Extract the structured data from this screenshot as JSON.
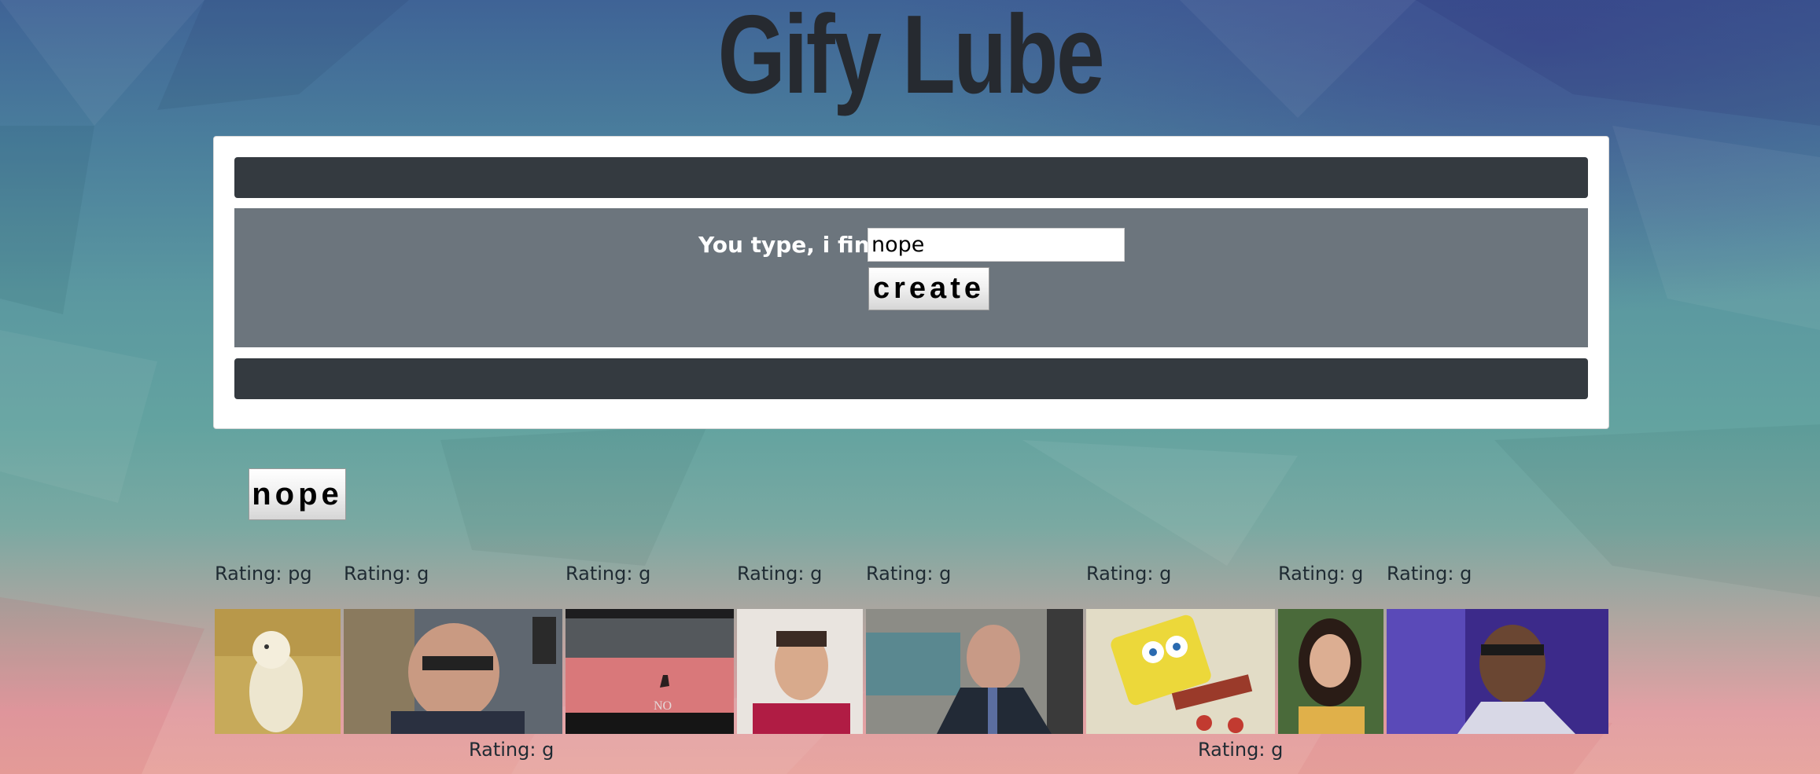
{
  "app": {
    "title": "Gify Lube"
  },
  "form": {
    "label": "You type, i find",
    "input_value": "nope",
    "create_label": "create"
  },
  "topics": [
    {
      "label": "nope"
    }
  ],
  "gifs": [
    {
      "rating": "Rating: pg",
      "subject": "white-cockatoo-gif"
    },
    {
      "rating": "Rating: g",
      "subject": "man-with-glasses-gif"
    },
    {
      "rating": "Rating: g",
      "subject": "deer-on-beach-no-gif"
    },
    {
      "rating": "Rating: g",
      "subject": "man-red-hoodie-gif"
    },
    {
      "rating": "Rating: g",
      "subject": "man-in-suit-office-gif"
    },
    {
      "rating": "Rating: g",
      "subject": "spongebob-gif"
    },
    {
      "rating": "Rating: g",
      "subject": "woman-yellow-top-gif"
    },
    {
      "rating": "Rating: g",
      "subject": "man-laughing-glasses-gif"
    },
    {
      "rating": "Rating: g",
      "subject": "wrapped-gif-1"
    },
    {
      "rating": "Rating: g",
      "subject": "wrapped-gif-2"
    }
  ],
  "colors": {
    "panel_bar": "#343a40",
    "form_bg": "#6c757d",
    "title": "#262a30"
  }
}
